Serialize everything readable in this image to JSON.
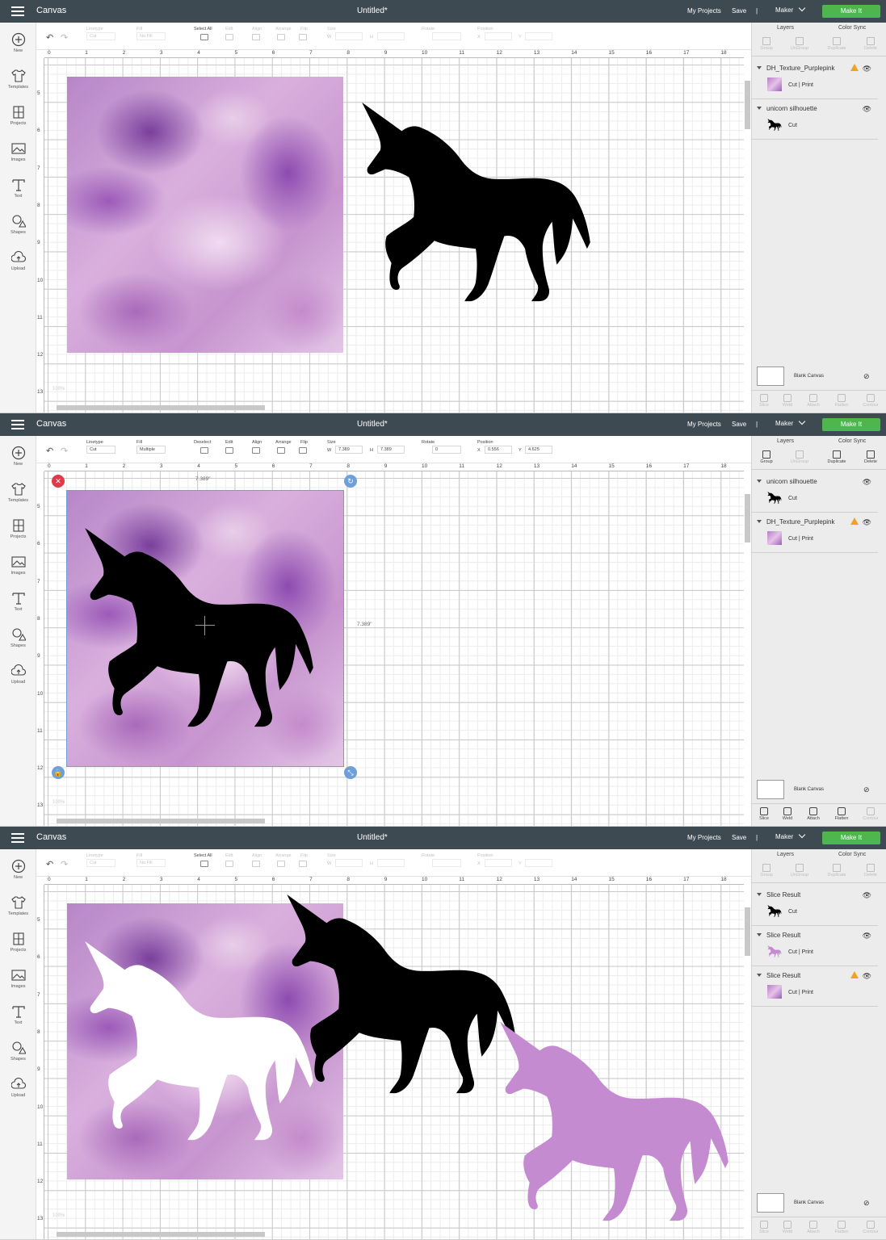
{
  "colors": {
    "topbar": "#3e4a52",
    "make_button": "#4eb54f",
    "selection": "#6f9fd9",
    "delete_handle": "#e0394a",
    "warning": "#f0a31f",
    "silhouette": "#000000"
  },
  "app": {
    "title": "Canvas",
    "doc_title": "Untitled*",
    "my_projects": "My Projects",
    "save": "Save",
    "separator": "|",
    "maker": "Maker",
    "make_it": "Make It"
  },
  "left_nav": [
    {
      "label": "New",
      "icon": "plus-icon"
    },
    {
      "label": "Templates",
      "icon": "shirt-icon"
    },
    {
      "label": "Projects",
      "icon": "projects-icon"
    },
    {
      "label": "Images",
      "icon": "image-icon"
    },
    {
      "label": "Text",
      "icon": "text-icon"
    },
    {
      "label": "Shapes",
      "icon": "shapes-icon"
    },
    {
      "label": "Upload",
      "icon": "upload-icon"
    }
  ],
  "toolbar": {
    "linetype_label": "Linetype",
    "fill_label": "Fill",
    "select_all_label": "Select All",
    "deselect_label": "Deselect",
    "edit_label": "Edit",
    "align_label": "Align",
    "arrange_label": "Arrange",
    "flip_label": "Flip",
    "size_label": "Size",
    "rotate_label": "Rotate",
    "position_label": "Position",
    "linetype_value": "Cut",
    "fill_value_nofill": "No Fill",
    "fill_value_multiple": "Multiple",
    "fill_q": "?",
    "w_label": "W",
    "h_label": "H",
    "x_label": "X",
    "y_label": "Y",
    "w_value": "7.389",
    "h_value": "7.389",
    "rotate_value": "0",
    "x_value": "0.556",
    "y_value": "4.625"
  },
  "ruler": {
    "top": [
      "0",
      "1",
      "2",
      "3",
      "4",
      "5",
      "6",
      "7",
      "8",
      "9",
      "10",
      "11",
      "12",
      "13",
      "14",
      "15",
      "16",
      "17",
      "18"
    ],
    "left": [
      "5",
      "6",
      "7",
      "8",
      "9",
      "10",
      "11",
      "12",
      "13"
    ]
  },
  "canvas": {
    "zoom": "100%",
    "dim_width": "7.389\"",
    "dim_height": "7.389\""
  },
  "right_panel": {
    "tab_layers": "Layers",
    "tab_color_sync": "Color Sync",
    "actions": [
      "Group",
      "UnGroup",
      "Duplicate",
      "Delete"
    ],
    "bottom_tools": [
      "Slice",
      "Weld",
      "Attach",
      "Flatten",
      "Contour"
    ],
    "blank_canvas": "Blank Canvas"
  },
  "panels": [
    {
      "layers": [
        {
          "name": "DH_Texture_Purplepink",
          "sub": "Cut  |  Print",
          "warning": true,
          "thumb": "watercolor"
        },
        {
          "name": "unicorn silhouette",
          "sub": "Cut",
          "warning": false,
          "thumb": "unicorn"
        }
      ]
    },
    {
      "layers": [
        {
          "name": "unicorn silhouette",
          "sub": "Cut",
          "warning": false,
          "thumb": "unicorn"
        },
        {
          "name": "DH_Texture_Purplepink",
          "sub": "Cut  |  Print",
          "warning": true,
          "thumb": "watercolor"
        }
      ]
    },
    {
      "layers": [
        {
          "name": "Slice Result",
          "sub": "Cut",
          "warning": false,
          "thumb": "unicorn"
        },
        {
          "name": "Slice Result",
          "sub": "Cut  |  Print",
          "warning": false,
          "thumb": "unicorn-wc"
        },
        {
          "name": "Slice Result",
          "sub": "Cut  |  Print",
          "warning": true,
          "thumb": "watercolor"
        }
      ]
    }
  ]
}
